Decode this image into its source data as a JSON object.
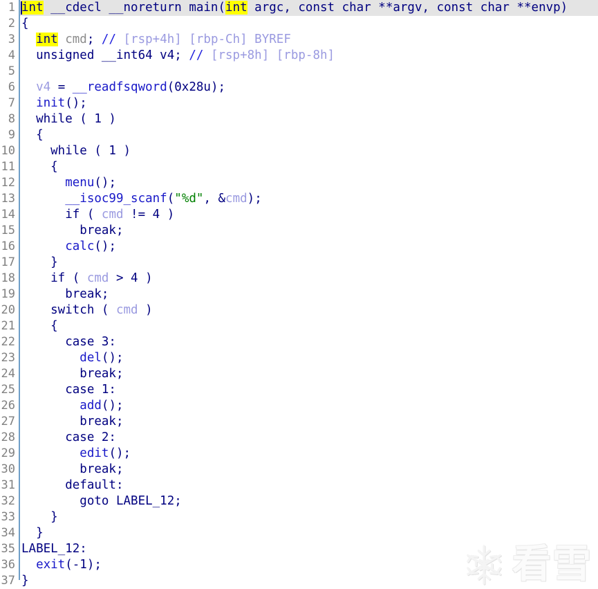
{
  "view": {
    "name": "hex-rays-pseudocode",
    "title": "Pseudocode-A",
    "current_line": 1,
    "highlighted_identifier": "int",
    "colors": {
      "background": "#ffffff",
      "current_line_bg": "#e4e4e4",
      "highlight_bg": "#ffff00",
      "keyword": "#000080",
      "function": "#1818c8",
      "local_var": "#9a9ae0",
      "declared_var": "#8c8c8c",
      "comment_slashes": "#2222dd",
      "comment_body": "#9a9ae0",
      "string": "#008000",
      "line_number": "#808080",
      "gutter_rule": "#6f9fc8"
    }
  },
  "watermark": {
    "icon": "snowflake-icon",
    "text": "看雪"
  },
  "lines": [
    {
      "n": "1",
      "tokens": [
        {
          "t": "int",
          "c": "kw",
          "hl": true
        },
        {
          "t": " __cdecl __noreturn ",
          "c": "kw"
        },
        {
          "t": "main",
          "c": "kw"
        },
        {
          "t": "(",
          "c": "kw"
        },
        {
          "t": "int",
          "c": "kw",
          "hl": true
        },
        {
          "t": " argc, const char **argv, const char **envp)",
          "c": "kw"
        }
      ]
    },
    {
      "n": "2",
      "tokens": [
        {
          "t": "{",
          "c": "kw"
        }
      ]
    },
    {
      "n": "3",
      "tokens": [
        {
          "t": "  ",
          "c": "kw"
        },
        {
          "t": "int",
          "c": "kw",
          "hl": true
        },
        {
          "t": " ",
          "c": "kw"
        },
        {
          "t": "cmd",
          "c": "decl"
        },
        {
          "t": "; ",
          "c": "kw"
        },
        {
          "t": "//",
          "c": "cmt"
        },
        {
          "t": " [rsp+4h] [rbp-Ch] BYREF",
          "c": "cmt2"
        }
      ]
    },
    {
      "n": "4",
      "tokens": [
        {
          "t": "  unsigned __int64 v4; ",
          "c": "kw"
        },
        {
          "t": "//",
          "c": "cmt"
        },
        {
          "t": " [rsp+8h] [rbp-8h]",
          "c": "cmt2"
        }
      ]
    },
    {
      "n": "5",
      "tokens": [
        {
          "t": "",
          "c": "kw"
        }
      ]
    },
    {
      "n": "6",
      "tokens": [
        {
          "t": "  ",
          "c": "kw"
        },
        {
          "t": "v4",
          "c": "var"
        },
        {
          "t": " = ",
          "c": "kw"
        },
        {
          "t": "__readfsqword",
          "c": "fn"
        },
        {
          "t": "(0x28u);",
          "c": "kw"
        }
      ]
    },
    {
      "n": "7",
      "tokens": [
        {
          "t": "  ",
          "c": "kw"
        },
        {
          "t": "init",
          "c": "fn"
        },
        {
          "t": "();",
          "c": "kw"
        }
      ]
    },
    {
      "n": "8",
      "tokens": [
        {
          "t": "  while ( 1 )",
          "c": "kw"
        }
      ]
    },
    {
      "n": "9",
      "tokens": [
        {
          "t": "  {",
          "c": "kw"
        }
      ]
    },
    {
      "n": "10",
      "tokens": [
        {
          "t": "    while ( 1 )",
          "c": "kw"
        }
      ]
    },
    {
      "n": "11",
      "tokens": [
        {
          "t": "    {",
          "c": "kw"
        }
      ]
    },
    {
      "n": "12",
      "tokens": [
        {
          "t": "      ",
          "c": "kw"
        },
        {
          "t": "menu",
          "c": "fn"
        },
        {
          "t": "();",
          "c": "kw"
        }
      ]
    },
    {
      "n": "13",
      "tokens": [
        {
          "t": "      ",
          "c": "kw"
        },
        {
          "t": "__isoc99_scanf",
          "c": "fn"
        },
        {
          "t": "(",
          "c": "kw"
        },
        {
          "t": "\"%d\"",
          "c": "str"
        },
        {
          "t": ", &",
          "c": "kw"
        },
        {
          "t": "cmd",
          "c": "var"
        },
        {
          "t": ");",
          "c": "kw"
        }
      ]
    },
    {
      "n": "14",
      "tokens": [
        {
          "t": "      if ( ",
          "c": "kw"
        },
        {
          "t": "cmd",
          "c": "var"
        },
        {
          "t": " != 4 )",
          "c": "kw"
        }
      ]
    },
    {
      "n": "15",
      "tokens": [
        {
          "t": "        break;",
          "c": "kw"
        }
      ]
    },
    {
      "n": "16",
      "tokens": [
        {
          "t": "      ",
          "c": "kw"
        },
        {
          "t": "calc",
          "c": "fn"
        },
        {
          "t": "();",
          "c": "kw"
        }
      ]
    },
    {
      "n": "17",
      "tokens": [
        {
          "t": "    }",
          "c": "kw"
        }
      ]
    },
    {
      "n": "18",
      "tokens": [
        {
          "t": "    if ( ",
          "c": "kw"
        },
        {
          "t": "cmd",
          "c": "var"
        },
        {
          "t": " > 4 )",
          "c": "kw"
        }
      ]
    },
    {
      "n": "19",
      "tokens": [
        {
          "t": "      break;",
          "c": "kw"
        }
      ]
    },
    {
      "n": "20",
      "tokens": [
        {
          "t": "    switch ( ",
          "c": "kw"
        },
        {
          "t": "cmd",
          "c": "var"
        },
        {
          "t": " )",
          "c": "kw"
        }
      ]
    },
    {
      "n": "21",
      "tokens": [
        {
          "t": "    {",
          "c": "kw"
        }
      ]
    },
    {
      "n": "22",
      "tokens": [
        {
          "t": "      case 3:",
          "c": "kw"
        }
      ]
    },
    {
      "n": "23",
      "tokens": [
        {
          "t": "        ",
          "c": "kw"
        },
        {
          "t": "del",
          "c": "fn"
        },
        {
          "t": "();",
          "c": "kw"
        }
      ]
    },
    {
      "n": "24",
      "tokens": [
        {
          "t": "        break;",
          "c": "kw"
        }
      ]
    },
    {
      "n": "25",
      "tokens": [
        {
          "t": "      case 1:",
          "c": "kw"
        }
      ]
    },
    {
      "n": "26",
      "tokens": [
        {
          "t": "        ",
          "c": "kw"
        },
        {
          "t": "add",
          "c": "fn"
        },
        {
          "t": "();",
          "c": "kw"
        }
      ]
    },
    {
      "n": "27",
      "tokens": [
        {
          "t": "        break;",
          "c": "kw"
        }
      ]
    },
    {
      "n": "28",
      "tokens": [
        {
          "t": "      case 2:",
          "c": "kw"
        }
      ]
    },
    {
      "n": "29",
      "tokens": [
        {
          "t": "        ",
          "c": "kw"
        },
        {
          "t": "edit",
          "c": "fn"
        },
        {
          "t": "();",
          "c": "kw"
        }
      ]
    },
    {
      "n": "30",
      "tokens": [
        {
          "t": "        break;",
          "c": "kw"
        }
      ]
    },
    {
      "n": "31",
      "tokens": [
        {
          "t": "      default:",
          "c": "kw"
        }
      ]
    },
    {
      "n": "32",
      "tokens": [
        {
          "t": "        goto ",
          "c": "kw"
        },
        {
          "t": "LABEL_12",
          "c": "lbl"
        },
        {
          "t": ";",
          "c": "kw"
        }
      ]
    },
    {
      "n": "33",
      "tokens": [
        {
          "t": "    }",
          "c": "kw"
        }
      ]
    },
    {
      "n": "34",
      "tokens": [
        {
          "t": "  }",
          "c": "kw"
        }
      ]
    },
    {
      "n": "35",
      "tokens": [
        {
          "t": "LABEL_12",
          "c": "lbl"
        },
        {
          "t": ":",
          "c": "kw"
        }
      ]
    },
    {
      "n": "36",
      "tokens": [
        {
          "t": "  ",
          "c": "kw"
        },
        {
          "t": "exit",
          "c": "fn"
        },
        {
          "t": "(-1);",
          "c": "kw"
        }
      ]
    },
    {
      "n": "37",
      "tokens": [
        {
          "t": "}",
          "c": "kw"
        }
      ]
    }
  ]
}
